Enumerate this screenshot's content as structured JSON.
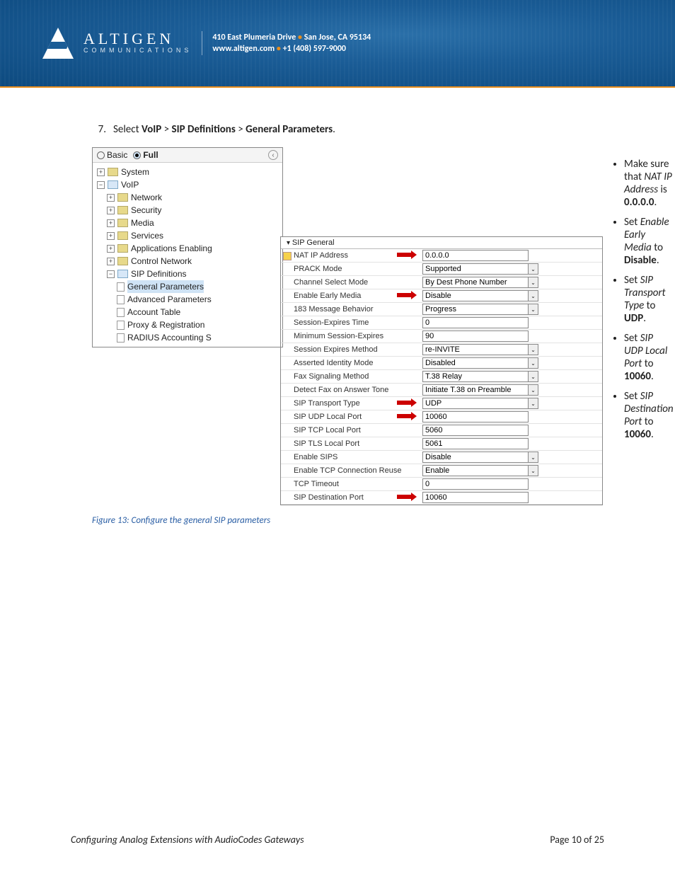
{
  "header": {
    "brand": "ALTIGEN",
    "brand_sub": "COMMUNICATIONS",
    "addr1_a": "410 East Plumeria Drive",
    "addr1_b": "San Jose, CA 95134",
    "addr2_a": "www.altigen.com",
    "addr2_b": "+1 (408) 597-9000"
  },
  "step": {
    "num": "7.",
    "pre": "Select ",
    "p1": "VoIP",
    "sep": " > ",
    "p2": "SIP Definitions",
    "p3": "General Parameters",
    "end": "."
  },
  "bullets": {
    "b1a": "Make sure that ",
    "b1i": "NAT IP Address",
    "b1b": " is ",
    "b1s": "0.0.0.0",
    "b1e": ".",
    "b2a": "Set ",
    "b2i": "Enable Early Media",
    "b2b": " to ",
    "b2s": "Disable",
    "b2e": ".",
    "b3a": "Set ",
    "b3i": "SIP Transport Type",
    "b3b": " to ",
    "b3s": "UDP",
    "b3e": ".",
    "b4a": "Set ",
    "b4i": "SIP UDP Local Port",
    "b4b": " to ",
    "b4s": "10060",
    "b4e": ".",
    "b5a": "Set ",
    "b5i": "SIP Destination Port",
    "b5b": " to ",
    "b5s": "10060",
    "b5e": "."
  },
  "tree": {
    "mode_basic": "Basic",
    "mode_full": "Full",
    "items": {
      "system": "System",
      "voip": "VoIP",
      "network": "Network",
      "security": "Security",
      "media": "Media",
      "services": "Services",
      "apps": "Applications Enabling",
      "ctrl": "Control Network",
      "sipdef": "SIP Definitions",
      "gen": "General Parameters",
      "adv": "Advanced Parameters",
      "acct": "Account Table",
      "proxy": "Proxy & Registration",
      "radius": "RADIUS Accounting S"
    }
  },
  "form": {
    "title": "SIP General",
    "rows": [
      {
        "label": "NAT IP Address",
        "value": "0.0.0.0",
        "type": "text",
        "arrow": true,
        "mod": true
      },
      {
        "label": "PRACK Mode",
        "value": "Supported",
        "type": "select"
      },
      {
        "label": "Channel Select Mode",
        "value": "By Dest Phone Number",
        "type": "select"
      },
      {
        "label": "Enable Early Media",
        "value": "Disable",
        "type": "select",
        "arrow": true
      },
      {
        "label": "183 Message Behavior",
        "value": "Progress",
        "type": "select"
      },
      {
        "label": "Session-Expires Time",
        "value": "0",
        "type": "text"
      },
      {
        "label": "Minimum Session-Expires",
        "value": "90",
        "type": "text"
      },
      {
        "label": "Session Expires Method",
        "value": "re-INVITE",
        "type": "select"
      },
      {
        "label": "Asserted Identity Mode",
        "value": "Disabled",
        "type": "select"
      },
      {
        "label": "Fax Signaling Method",
        "value": "T.38 Relay",
        "type": "select"
      },
      {
        "label": "Detect Fax on Answer Tone",
        "value": "Initiate T.38 on Preamble",
        "type": "select"
      },
      {
        "label": "SIP Transport Type",
        "value": "UDP",
        "type": "select",
        "arrow": true
      },
      {
        "label": "SIP UDP Local Port",
        "value": "10060",
        "type": "text",
        "arrow": true
      },
      {
        "label": "SIP TCP Local Port",
        "value": "5060",
        "type": "text"
      },
      {
        "label": "SIP TLS Local Port",
        "value": "5061",
        "type": "text"
      },
      {
        "label": "Enable SIPS",
        "value": "Disable",
        "type": "select"
      },
      {
        "label": "Enable TCP Connection Reuse",
        "value": "Enable",
        "type": "select"
      },
      {
        "label": "TCP Timeout",
        "value": "0",
        "type": "text"
      },
      {
        "label": "SIP Destination Port",
        "value": "10060",
        "type": "text",
        "arrow": true
      }
    ]
  },
  "caption": "Figure 13: Configure the general SIP parameters",
  "footer": {
    "title": "Configuring Analog Extensions with AudioCodes Gateways",
    "page": "Page 10 of 25"
  }
}
